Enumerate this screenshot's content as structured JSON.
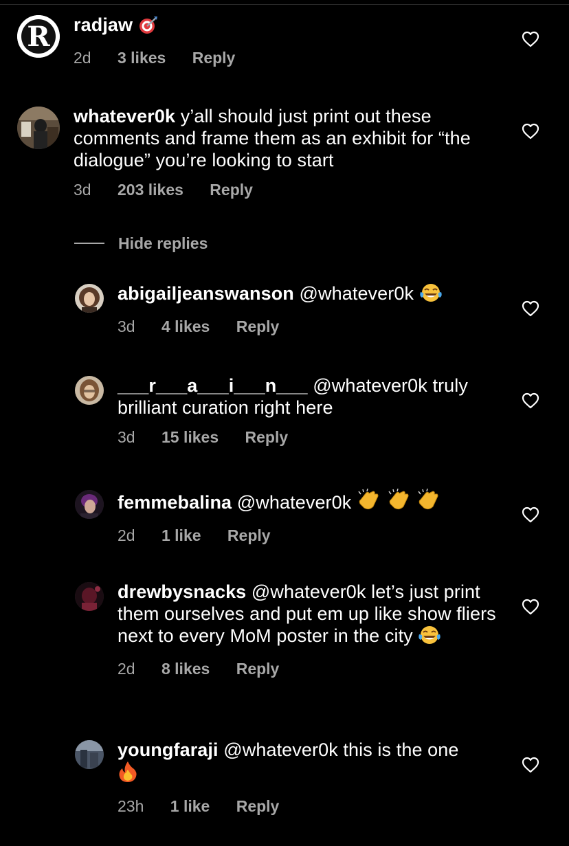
{
  "comments": [
    {
      "username": "radjaw",
      "text": "",
      "time": "2d",
      "likes": "3 likes",
      "reply": "Reply"
    },
    {
      "username": "whatever0k",
      "text": "y’all should just print out these comments and frame them as an exhibit for “the dialogue” you’re looking to start",
      "time": "3d",
      "likes": "203 likes",
      "reply": "Reply"
    }
  ],
  "hide_replies": "Hide replies",
  "replies": [
    {
      "username": "abigailjeanswanson",
      "text": "@whatever0k",
      "time": "3d",
      "likes": "4 likes",
      "reply": "Reply"
    },
    {
      "username": "___r___a___i___n___",
      "text": "@whatever0k truly brilliant curation right here",
      "time": "3d",
      "likes": "15 likes",
      "reply": "Reply"
    },
    {
      "username": "femmebalina",
      "text": "@whatever0k",
      "time": "2d",
      "likes": "1 like",
      "reply": "Reply"
    },
    {
      "username": "drewbysnacks",
      "text": "@whatever0k let’s just print them ourselves and put em up like show fliers next to every MoM poster in the city",
      "time": "2d",
      "likes": "8 likes",
      "reply": "Reply"
    },
    {
      "username": "youngfaraji",
      "text": "@whatever0k this is the one",
      "time": "23h",
      "likes": "1 like",
      "reply": "Reply"
    }
  ],
  "icons": {
    "heart": "heart-outline-icon",
    "target": "direct-hit-emoji",
    "laugh": "tears-of-joy-emoji",
    "clap": "clapping-hands-emoji",
    "fire": "fire-emoji"
  },
  "colors": {
    "background": "#000000",
    "text": "#ffffff",
    "secondary": "#a8a8a8"
  }
}
